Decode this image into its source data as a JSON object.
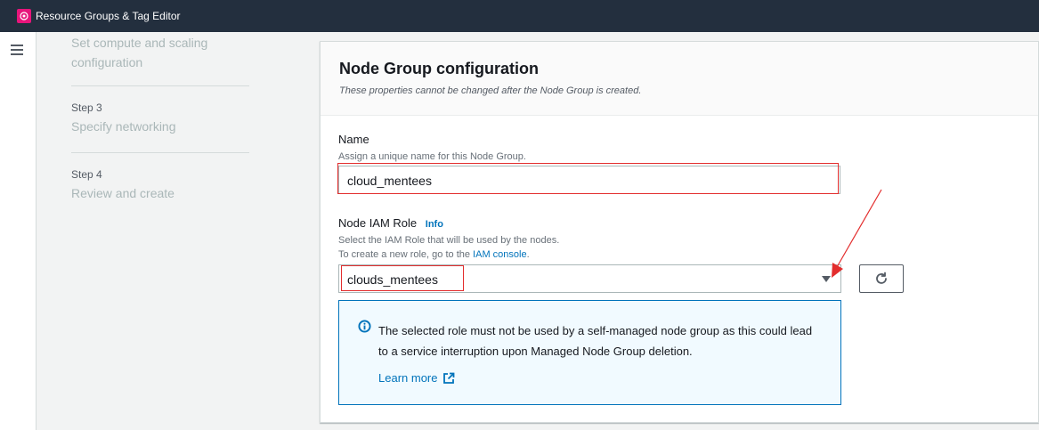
{
  "app": {
    "title": "Resource Groups & Tag Editor",
    "icon": "resource-groups-icon",
    "brand_color": "#e7157b"
  },
  "nav": {
    "menu_icon": "hamburger-menu-icon"
  },
  "steps": [
    {
      "number": "",
      "title": "Set compute and scaling configuration"
    },
    {
      "number": "Step 3",
      "title": "Specify networking"
    },
    {
      "number": "Step 4",
      "title": "Review and create"
    }
  ],
  "panel": {
    "title": "Node Group configuration",
    "description": "These properties cannot be changed after the Node Group is created."
  },
  "name_field": {
    "label": "Name",
    "description": "Assign a unique name for this Node Group.",
    "value": "cloud_mentees"
  },
  "role_field": {
    "label": "Node IAM Role",
    "info_link": "Info",
    "description": "Select the IAM Role that will be used by the nodes.",
    "description2_prefix": "To create a new role, go to the",
    "description2_link": "IAM console",
    "description2_suffix": ".",
    "selected": "clouds_mentees"
  },
  "alert": {
    "icon": "info-icon",
    "text": "The selected role must not be used by a self-managed node group as this could lead to a service interruption upon Managed Node Group deletion.",
    "link": "Learn more",
    "link_icon": "external-link-icon"
  },
  "colors": {
    "annotation": "#e32d2d",
    "link": "#0073bb",
    "topbar": "#232f3e"
  }
}
